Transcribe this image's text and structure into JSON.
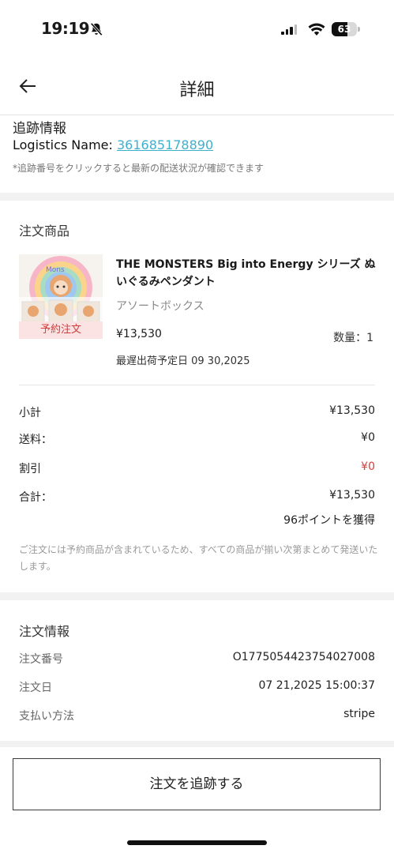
{
  "status_bar": {
    "time": "19:19",
    "battery": "63",
    "battery_level": 0.63
  },
  "header": {
    "title": "詳細"
  },
  "tracking": {
    "title": "追跡情報",
    "logistics_label": "Logistics Name: ",
    "logistics_number": "361685178890",
    "note": "*追跡番号をクリックすると最新の配送状況が確認できます"
  },
  "order_items": {
    "title": "注文商品",
    "product": {
      "name": "THE MONSTERS Big into Energy シリーズ ぬいぐるみペンダント",
      "variant": "アソートボックス",
      "price": "¥13,530",
      "quantity": "数量：1",
      "preorder_tag": "予約注文",
      "ship_date": "最遅出荷予定日 09 30,2025"
    },
    "summary": {
      "subtotal_label": "小計",
      "subtotal": "¥13,530",
      "shipping_label": "送料：",
      "shipping": "¥0",
      "discount_label": "割引",
      "discount": "¥0",
      "total_label": "合計：",
      "total": "¥13,530",
      "points": "96ポイントを獲得"
    },
    "note": "ご注文には予約商品が含まれているため、すべての商品が揃い次第まとめて発送いたします。"
  },
  "order_info": {
    "title": "注文情報",
    "number_label": "注文番号",
    "number": "O1775054423754027008",
    "date_label": "注文日",
    "date": "07 21,2025 15:00:37",
    "payment_label": "支払い方法",
    "payment": "stripe"
  },
  "button": {
    "track_label": "注文を追跡する"
  },
  "colors": {
    "link": "#3fb0cc",
    "discount": "#d24040",
    "preorder_bg": "#fbe3e3",
    "preorder_text": "#d23a3a",
    "section_gap": "#f2f2f2"
  }
}
